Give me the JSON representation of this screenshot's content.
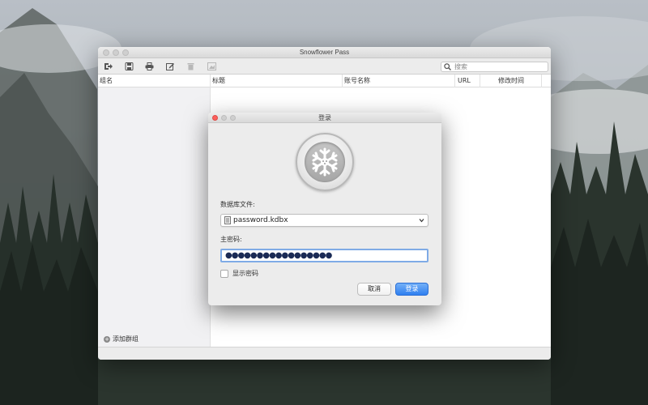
{
  "window": {
    "title": "Snowflower Pass"
  },
  "search": {
    "placeholder": "搜索"
  },
  "columns": {
    "group": "组名",
    "title": "标题",
    "account": "账号名称",
    "url": "URL",
    "modified": "修改时间"
  },
  "sidebar": {
    "add_group_label": "添加群组"
  },
  "toolbar": {
    "icons": [
      "sign-out-icon",
      "save-icon",
      "print-icon",
      "edit-icon",
      "trash-icon",
      "image-icon"
    ]
  },
  "dialog": {
    "title": "登录",
    "database_label": "数据库文件:",
    "database_value": "password.kdbx",
    "password_label": "主密码:",
    "password_mask": "●●●●●●●●●●●●●●●●●",
    "show_password_label": "显示密码",
    "show_password_checked": false,
    "cancel_label": "取消",
    "login_label": "登录"
  },
  "colors": {
    "accent": "#2f7ff0",
    "close": "#fc605c",
    "focus_ring": "#7fabe6"
  }
}
